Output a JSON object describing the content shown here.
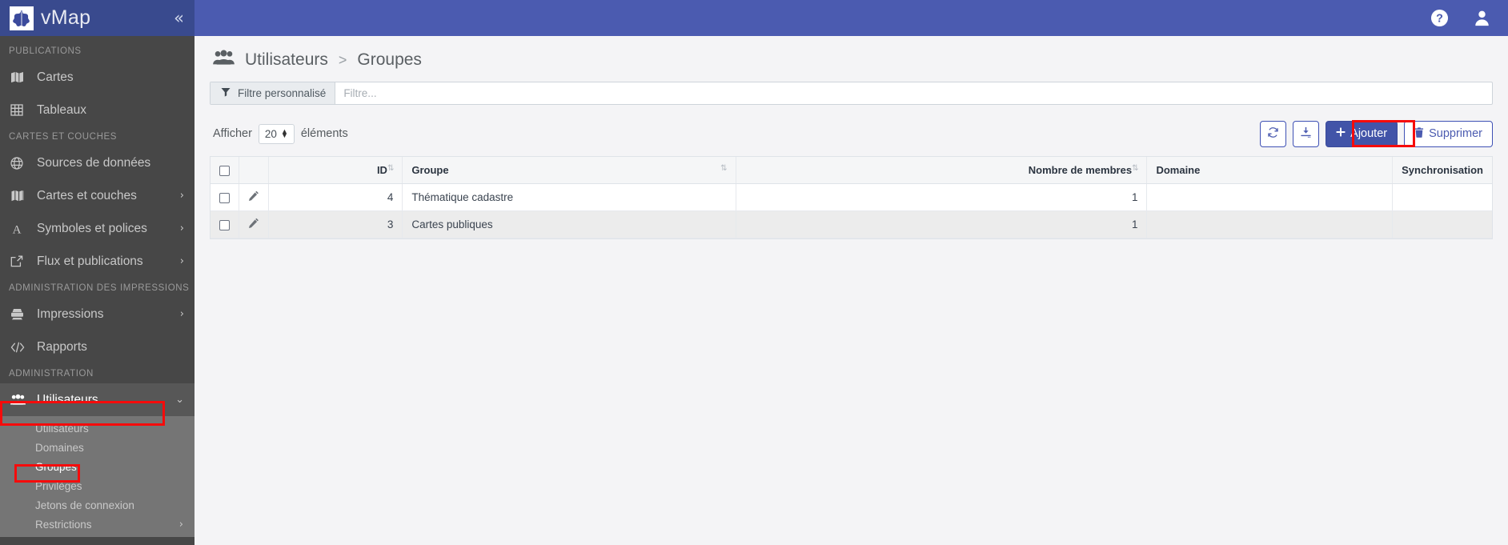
{
  "brand": {
    "name": "vMap",
    "logo_icon": "leaf-logo-icon",
    "collapse_icon": "«"
  },
  "topbar": {
    "help_icon": "help-circle-icon",
    "user_icon": "user-account-icon"
  },
  "sidebar": {
    "sections": [
      {
        "label": "PUBLICATIONS",
        "items": [
          {
            "label": "Cartes",
            "icon": "map-icon",
            "chevron": ""
          },
          {
            "label": "Tableaux",
            "icon": "table-grid-icon",
            "chevron": ""
          }
        ]
      },
      {
        "label": "CARTES ET COUCHES",
        "items": [
          {
            "label": "Sources de données",
            "icon": "globe-icon",
            "chevron": ""
          },
          {
            "label": "Cartes et couches",
            "icon": "layers-map-icon",
            "chevron": "›"
          },
          {
            "label": "Symboles et polices",
            "icon": "font-letter-a-icon",
            "chevron": "›"
          },
          {
            "label": "Flux et publications",
            "icon": "external-link-icon",
            "chevron": "›"
          }
        ]
      },
      {
        "label": "ADMINISTRATION DES IMPRESSIONS",
        "items": [
          {
            "label": "Impressions",
            "icon": "printer-icon",
            "chevron": "›"
          },
          {
            "label": "Rapports",
            "icon": "code-brackets-icon",
            "chevron": ""
          }
        ]
      },
      {
        "label": "ADMINISTRATION",
        "items": [
          {
            "label": "Utilisateurs",
            "icon": "users-group-icon",
            "chevron": "⌄",
            "active": true
          }
        ]
      }
    ],
    "submenu": [
      {
        "label": "Utilisateurs",
        "chevron": "",
        "active": false
      },
      {
        "label": "Domaines",
        "chevron": "",
        "active": false
      },
      {
        "label": "Groupes",
        "chevron": "",
        "active": true
      },
      {
        "label": "Privilèges",
        "chevron": "",
        "active": false
      },
      {
        "label": "Jetons de connexion",
        "chevron": "",
        "active": false
      },
      {
        "label": "Restrictions",
        "chevron": "›",
        "active": false
      }
    ]
  },
  "page": {
    "icon": "users-group-icon",
    "breadcrumb_parent": "Utilisateurs",
    "breadcrumb_separator": ">",
    "breadcrumb_current": "Groupes"
  },
  "filter": {
    "icon": "funnel-filter-icon",
    "label": "Filtre personnalisé",
    "placeholder": "Filtre...",
    "value": ""
  },
  "toolbar": {
    "show_prefix": "Afficher",
    "page_size": "20",
    "show_suffix": "éléments",
    "refresh_icon": "refresh-icon",
    "export_icon": "download-export-icon",
    "add_label": "Ajouter",
    "add_icon": "plus-icon",
    "delete_label": "Supprimer",
    "delete_icon": "trash-icon"
  },
  "table": {
    "columns": [
      {
        "label": "",
        "sort": ""
      },
      {
        "label": "",
        "sort": ""
      },
      {
        "label": "ID",
        "sort": "⇅"
      },
      {
        "label": "Groupe",
        "sort": "⇅"
      },
      {
        "label": "Nombre de membres",
        "sort": "⇅"
      },
      {
        "label": "Domaine",
        "sort": ""
      },
      {
        "label": "Synchronisation",
        "sort": ""
      }
    ],
    "rows": [
      {
        "id": "4",
        "groupe": "Thématique cadastre",
        "nombre_de_membres": "1",
        "domaine": "",
        "synchronisation": ""
      },
      {
        "id": "3",
        "groupe": "Cartes publiques",
        "nombre_de_membres": "1",
        "domaine": "",
        "synchronisation": ""
      }
    ]
  },
  "colors": {
    "sidebar_header": "#394a8e",
    "topbar": "#4b5bb0",
    "sidebar_bg": "#474747",
    "submenu_bg": "#757575",
    "primary_button": "#4254a8",
    "annotation": "#f60b0b"
  }
}
